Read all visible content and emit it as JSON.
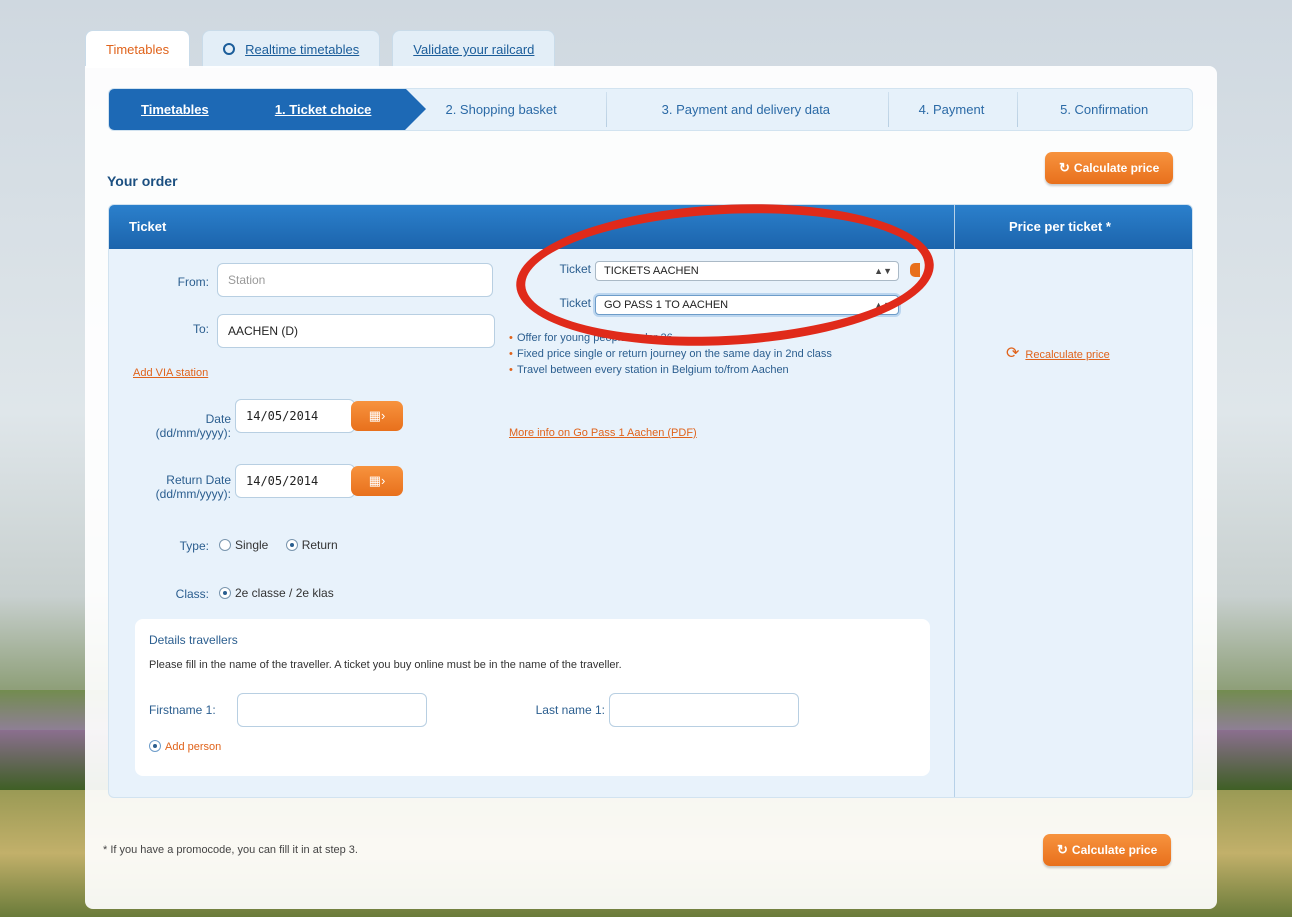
{
  "top_tabs": {
    "timetables": "Timetables",
    "realtime": "Realtime timetables",
    "validate": "Validate your railcard"
  },
  "steps": {
    "timetables": "Timetables",
    "ticket_choice": "1. Ticket choice",
    "shopping_basket": "2. Shopping basket",
    "payment_delivery": "3. Payment and delivery data",
    "payment": "4. Payment",
    "confirmation": "5. Confirmation"
  },
  "order": {
    "heading": "Your order",
    "calculate_price": "Calculate price",
    "col_ticket": "Ticket",
    "col_price": "Price per ticket *"
  },
  "form": {
    "from_label": "From:",
    "from_placeholder": "Station",
    "to_label": "To:",
    "to_value": "AACHEN (D)",
    "add_via": "Add VIA station",
    "date_label": "Date",
    "date_format": "(dd/mm/yyyy):",
    "date_value": "14/05/2014",
    "return_label": "Return Date",
    "return_value": "14/05/2014",
    "type_label": "Type:",
    "type_single": "Single",
    "type_return": "Return",
    "class_label": "Class:",
    "class_value": "2e classe / 2e klas"
  },
  "ticket": {
    "label1": "Ticket",
    "select1": "TICKETS AACHEN",
    "label2": "Ticket",
    "select2": "GO PASS 1 TO AACHEN",
    "bullets": [
      "Offer for young people under 26",
      "Fixed price single or return journey on the same day in 2nd class",
      "Travel between every station in Belgium to/from Aachen"
    ],
    "more_info": "More info on Go Pass 1 Aachen (PDF)"
  },
  "price": {
    "recalculate": "Recalculate price"
  },
  "travellers": {
    "title": "Details travellers",
    "note": "Please fill in the name of the traveller. A ticket you buy online must be in the name of the traveller.",
    "firstname_label": "Firstname 1:",
    "lastname_label": "Last name 1:",
    "add_person": "Add person"
  },
  "footnote": "* If you have a promocode, you can fill it in at step 3.",
  "colors": {
    "primary_blue": "#1d69b5",
    "accent_orange": "#e8701c",
    "annotation_red": "#e02a1a"
  }
}
